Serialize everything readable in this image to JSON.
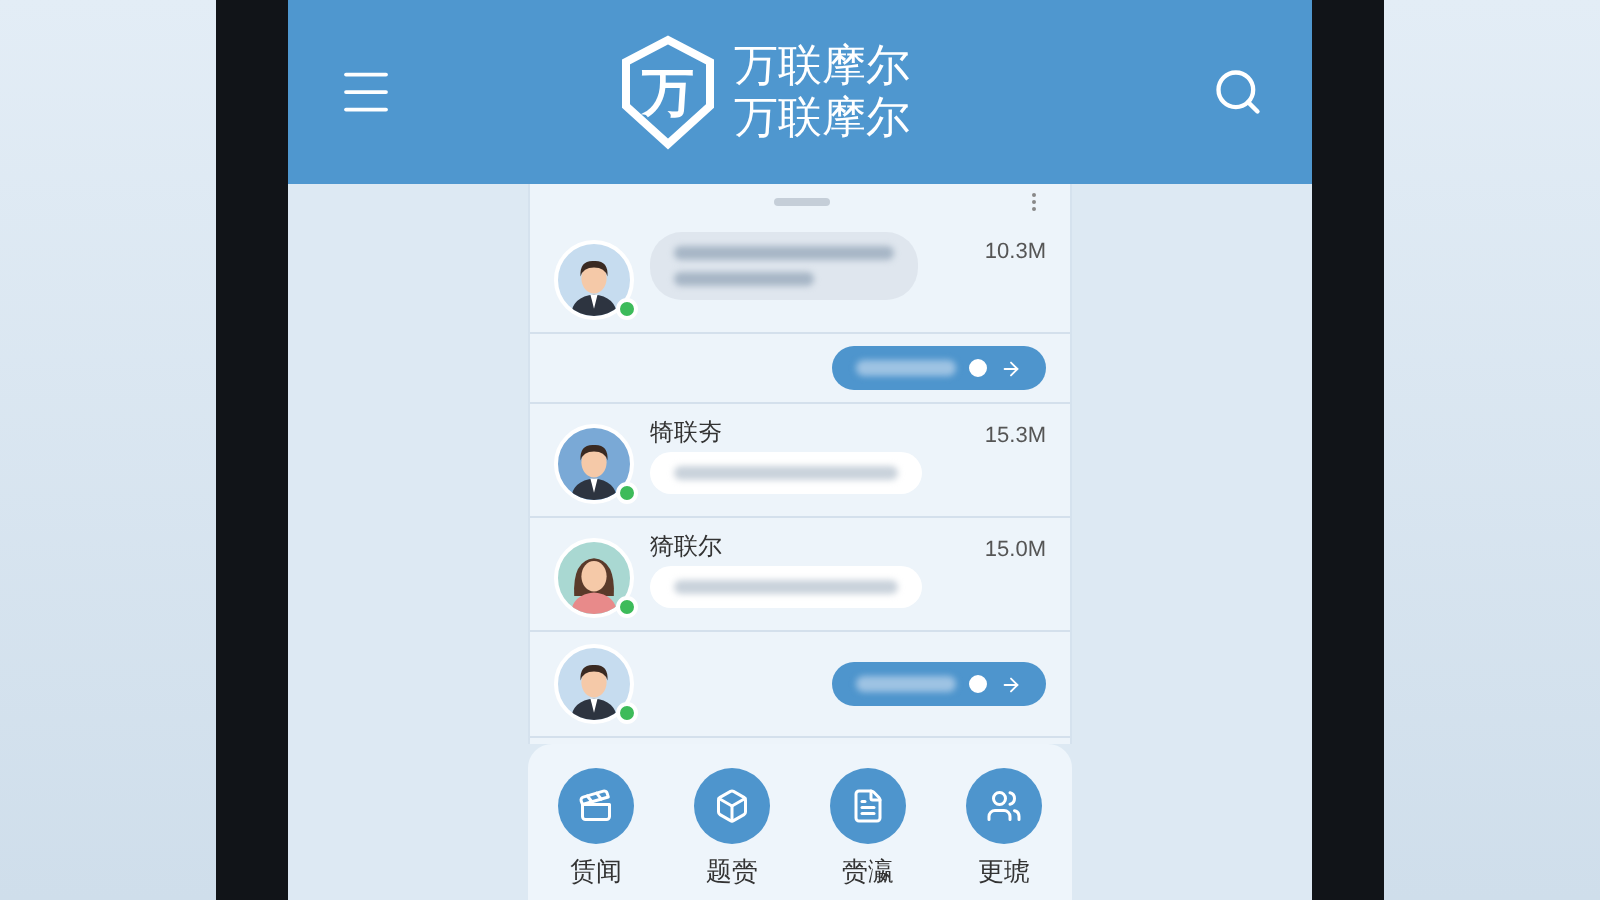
{
  "header": {
    "logo_mark": "万",
    "brand_lines": [
      "万联摩尔",
      "万联摩尔"
    ]
  },
  "messages": [
    {
      "kind": "incoming",
      "online": true,
      "size": "10.3M"
    },
    {
      "kind": "outgoing"
    },
    {
      "kind": "incoming",
      "online": true,
      "name": "犄联夯",
      "size": "15.3M"
    },
    {
      "kind": "incoming",
      "online": true,
      "name": "猗联尔",
      "size": "15.0M"
    },
    {
      "kind": "outgoing",
      "online": true
    }
  ],
  "dock": [
    {
      "label": "赁闻"
    },
    {
      "label": "题赍"
    },
    {
      "label": "赍瀛"
    },
    {
      "label": "更琥"
    }
  ]
}
